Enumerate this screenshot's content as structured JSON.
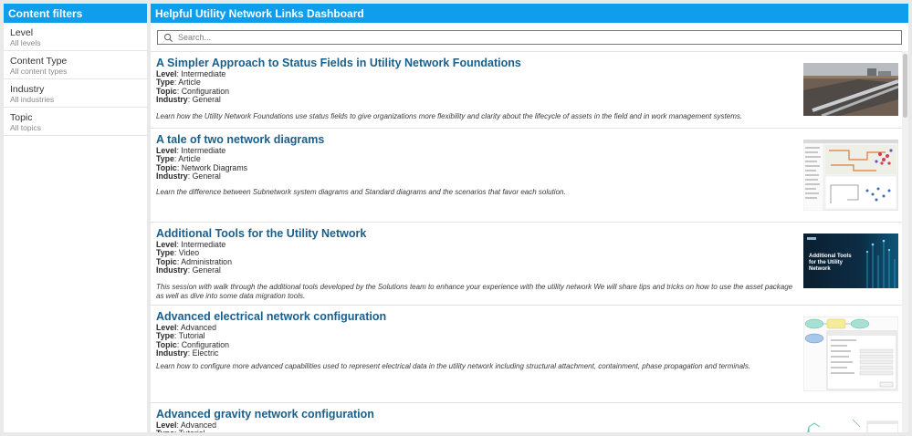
{
  "filters": {
    "header": "Content filters",
    "items": [
      {
        "label": "Level",
        "value": "All levels"
      },
      {
        "label": "Content Type",
        "value": "All content types"
      },
      {
        "label": "Industry",
        "value": "All industries"
      },
      {
        "label": "Topic",
        "value": "All topics"
      }
    ]
  },
  "main": {
    "header": "Helpful Utility Network Links Dashboard",
    "search_placeholder": "Search...",
    "meta_labels": {
      "level": "Level",
      "type": "Type",
      "topic": "Topic",
      "industry": "Industry"
    },
    "cards": [
      {
        "title": "A Simpler Approach to Status Fields in Utility Network Foundations",
        "level": "Intermediate",
        "type": "Article",
        "topic": "Configuration",
        "industry": "General",
        "description": "Learn how the Utility Network Foundations use status fields to give organizations more flexibility and clarity about the lifecycle of assets in the field and in work management systems.",
        "thumbnail": "pipeline-photo"
      },
      {
        "title": "A tale of two network diagrams",
        "level": "Intermediate",
        "type": "Article",
        "topic": "Network Diagrams",
        "industry": "General",
        "description": "Learn the difference between Subnetwork system diagrams and Standard diagrams and the scenarios that favor each solution.",
        "thumbnail": "network-diagram-screenshot"
      },
      {
        "title": "Additional Tools for the Utility Network",
        "level": "Intermediate",
        "type": "Video",
        "topic": "Administration",
        "industry": "General",
        "description": "This session with walk through the additional tools developed by the Solutions team to enhance your experience with the utility network We will share tips and tricks on how to use the asset package as well as dive into some data migration tools.",
        "thumbnail": "video-title-card",
        "thumb_title": "Additional Tools for the Utility Network"
      },
      {
        "title": "Advanced electrical network configuration",
        "level": "Advanced",
        "type": "Tutorial",
        "topic": "Configuration",
        "industry": "Electric",
        "description": "Learn how to configure more advanced capabilities used to represent electrical data in the utility network including structural attachment, containment, phase propagation and terminals.",
        "thumbnail": "configuration-dialog-screenshot"
      },
      {
        "title": "Advanced gravity network configuration",
        "level": "Advanced",
        "type": "Tutorial",
        "topic": "",
        "industry": "",
        "description": "",
        "thumbnail": "gravity-network-map"
      }
    ]
  }
}
